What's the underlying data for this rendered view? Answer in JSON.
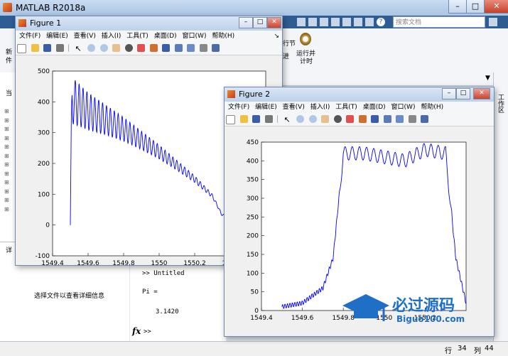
{
  "app": {
    "title": "MATLAB R2018a"
  },
  "toolstrip": {
    "search_placeholder": "搜索文档",
    "left_label_1": "新",
    "left_label_2": "件",
    "run_section_label": "运行并\n计时",
    "run_section_label_line1": "运行并",
    "run_section_label_line2": "计时",
    "section_label": "行节",
    "section_label_2": "进"
  },
  "left_panel": {
    "rows": [
      "⊞",
      "⊞",
      "⊞",
      "⊞",
      "⊞",
      "⊞",
      "⊞",
      "⊞",
      "⊞",
      "⊞",
      "⊞",
      "⊞"
    ],
    "tab": "详",
    "detail_text": "选择文件以查看详细信息",
    "top_label": "当"
  },
  "command_window": {
    "line1": ">> Untitled",
    "line2": "Pi =",
    "line3": "3.1420",
    "prompt": ">>"
  },
  "right_strip": {
    "label": "工作区"
  },
  "status": {
    "row_label": "行",
    "row_value": "34",
    "col_label": "列",
    "col_value": "44"
  },
  "figures": [
    {
      "title": "Figure 1",
      "menu": [
        "文件(F)",
        "编辑(E)",
        "查看(V)",
        "插入(I)",
        "工具(T)",
        "桌面(D)",
        "窗口(W)",
        "帮助(H)"
      ]
    },
    {
      "title": "Figure 2",
      "menu": [
        "文件(F)",
        "编辑(E)",
        "查看(V)",
        "插入(I)",
        "工具(T)",
        "桌面(D)",
        "窗口(W)",
        "帮助(H)"
      ]
    }
  ],
  "chart_data": [
    {
      "type": "line",
      "title": "",
      "xlabel": "",
      "ylabel": "",
      "xlim": [
        1549.4,
        1550.6
      ],
      "ylim": [
        -100,
        500
      ],
      "xticks": [
        "1549.4",
        "1549.6",
        "1549.8",
        "1550",
        "1550.2",
        "1550"
      ],
      "yticks": [
        "500",
        "400",
        "300",
        "200",
        "100",
        "0",
        "-100"
      ],
      "grid": false,
      "x": [
        1549.5,
        1549.505,
        1549.51,
        1549.6,
        1549.8,
        1550,
        1550.2,
        1550.3,
        1550.35,
        1550.4
      ],
      "y": [
        0,
        330,
        480,
        430,
        350,
        260,
        160,
        100,
        40,
        20
      ],
      "series": [
        {
          "color": "#0000ff"
        }
      ]
    },
    {
      "type": "line",
      "title": "",
      "xlabel": "",
      "ylabel": "",
      "xlim": [
        1549.4,
        1550.4
      ],
      "ylim": [
        0,
        450
      ],
      "xticks": [
        "1549.4",
        "1549.6",
        "1549.8",
        "1550",
        "1550.2"
      ],
      "yticks": [
        "450",
        "400",
        "350",
        "300",
        "250",
        "200",
        "150",
        "100",
        "50",
        "0"
      ],
      "grid": false,
      "x": [
        1549.5,
        1549.6,
        1549.7,
        1549.75,
        1549.8,
        1549.9,
        1550,
        1550.1,
        1550.2,
        1550.3,
        1550.35,
        1550.4
      ],
      "y": [
        10,
        20,
        60,
        140,
        420,
        420,
        410,
        400,
        430,
        420,
        140,
        20
      ],
      "series": [
        {
          "color": "#0000ff"
        }
      ]
    }
  ],
  "watermark": {
    "text": "必过源码",
    "url": "Biguo100.com"
  }
}
